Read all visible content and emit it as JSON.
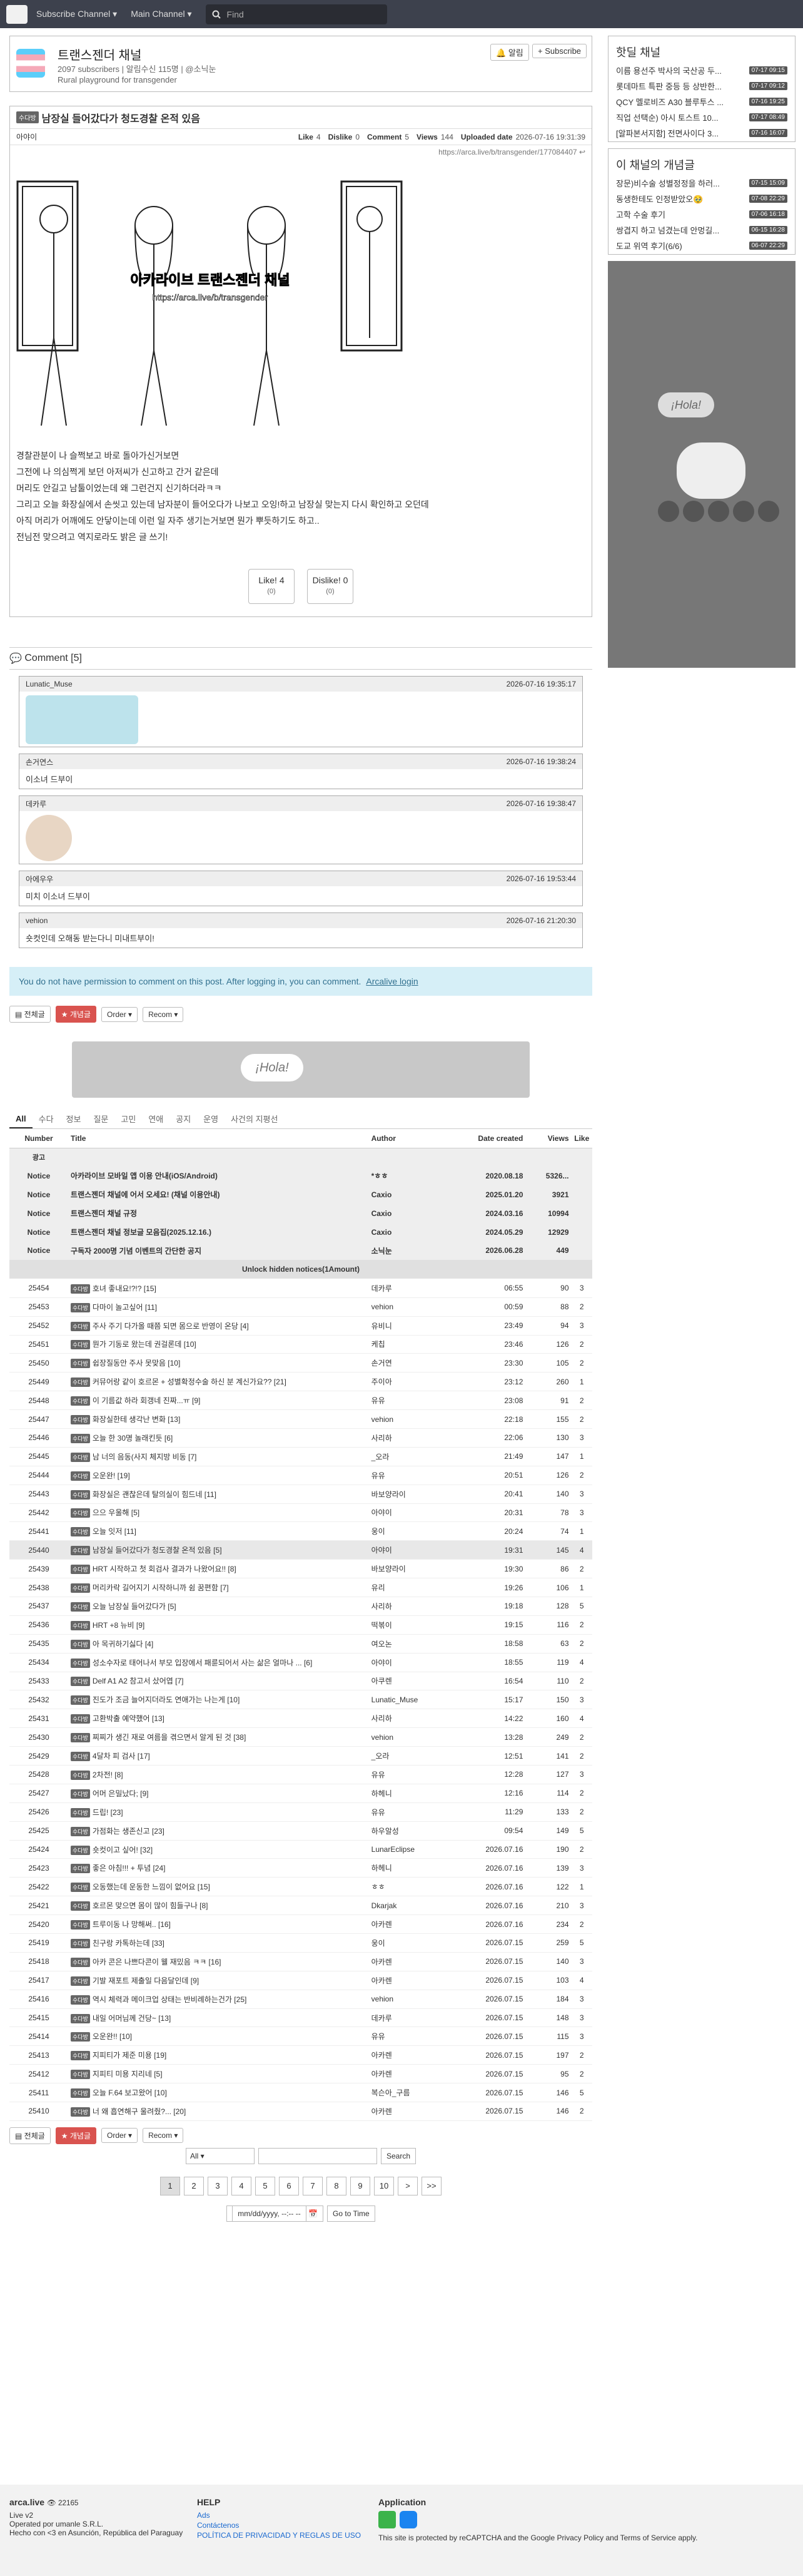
{
  "nav": {
    "subscribe_channel": "Subscribe Channel",
    "main_channel": "Main Channel",
    "find_placeholder": "Find"
  },
  "channel": {
    "title": "트랜스젠더 채널",
    "subscribers": "2097 subscribers",
    "notif": "알림수신 115명",
    "admin": "@소닉눈",
    "desc": "Rural playground for transgender",
    "notify_btn": "알림",
    "subscribe_btn": "Subscribe"
  },
  "article": {
    "category": "수다방",
    "title": "남장실 들어갔다가 청도경찰 온적 있음",
    "author": "아야이",
    "like_label": "Like",
    "like": "4",
    "dislike_label": "Dislike",
    "dislike": "0",
    "comment_label": "Comment",
    "comment": "5",
    "views_label": "Views",
    "views": "144",
    "uploaded_label": "Uploaded date",
    "uploaded": "2026-07-16 19:31:39",
    "url": "https://arca.live/b/transgender/177084407",
    "image_caption": "아카라이브 트랜스젠더 채널",
    "image_url": "https://arca.live/b/transgender",
    "body": [
      "경찰관분이 나 슬쩍보고 바로 돌아가신거보면",
      "그전에 나 의심쩍게 보던 아저씨가 신고하고 간거 같은데",
      "머리도 안길고 남툴이었는데 왜 그런건지 신기하더라ㅋㅋ",
      "그리고 오늘 화장실에서 손씻고 있는데 남자분이 들어오다가 나보고 오잉!하고 남장실 맞는지 다시 확인하고 오던데",
      "아직 머리가 어깨에도 안닿이는데 이런 일 자주 생기는거보면 뭔가 뿌듯하기도 하고..",
      "전님전 맞으려고 역지로라도 밝은 글 쓰기!"
    ],
    "like_btn": "Like!",
    "dislike_btn": "Dislike!",
    "like_sub": "(0)",
    "dislike_sub": "(0)"
  },
  "comments": {
    "header": "Comment [5]",
    "items": [
      {
        "author": "Lunatic_Muse",
        "time": "2026-07-16 19:35:17",
        "text": ""
      },
      {
        "author": "손거연스",
        "time": "2026-07-16 19:38:24",
        "text": "이소녀 드부이"
      },
      {
        "author": "데카루",
        "time": "2026-07-16 19:38:47",
        "text": ""
      },
      {
        "author": "아에우우",
        "time": "2026-07-16 19:53:44",
        "text": "미치 이소녀 드부이"
      },
      {
        "author": "vehion",
        "time": "2026-07-16 21:20:30",
        "text": "숏컷인데 오해동 받는다니 미내트부이!"
      }
    ]
  },
  "notice": {
    "text": "You do not have permission to comment on this post. After logging in, you can comment.",
    "link": "Arcalive login"
  },
  "controls": {
    "all": "전체글",
    "best": "개념글",
    "order": "Order",
    "recom": "Recom"
  },
  "tabs": [
    "All",
    "수다",
    "정보",
    "질문",
    "고민",
    "연애",
    "공지",
    "운영",
    "사건의 지평선"
  ],
  "table": {
    "headers": [
      "Number",
      "Title",
      "Author",
      "Date created",
      "Views",
      "Like"
    ],
    "ad": "광고",
    "notices": [
      {
        "n": "Notice",
        "t": "아카라이브 모바일 앱 이용 안내(iOS/Android)",
        "a": "*ㅎㅎ",
        "d": "2020.08.18",
        "v": "5326...",
        "l": ""
      },
      {
        "n": "Notice",
        "t": "트랜스젠더 채널에 어서 오세요! (채널 이용안내)",
        "a": "Caxio",
        "d": "2025.01.20",
        "v": "3921",
        "l": ""
      },
      {
        "n": "Notice",
        "t": "트랜스젠더 채널 규정",
        "a": "Caxio",
        "d": "2024.03.16",
        "v": "10994",
        "l": ""
      },
      {
        "n": "Notice",
        "t": "트랜스젠더 채널 정보글 모음집(2025.12.16.)",
        "a": "Caxio",
        "d": "2024.05.29",
        "v": "12929",
        "l": ""
      },
      {
        "n": "Notice",
        "t": "구독자 2000명 기념 이벤트의 간단한 공지",
        "a": "소닉눈",
        "d": "2026.06.28",
        "v": "449",
        "l": ""
      }
    ],
    "unlock": "Unlock hidden notices(1Amount)",
    "rows": [
      [
        "25454",
        "수다방",
        "호녀 좋내요!?!? [15]",
        "데카루",
        "06:55",
        "90",
        "3"
      ],
      [
        "25453",
        "수다방",
        "다마이 놀고싶어 [11]",
        "vehion",
        "00:59",
        "88",
        "2"
      ],
      [
        "25452",
        "수다방",
        "주사 주기 다가올 때쯤 되면 몸으로 반영이 온당 [4]",
        "유비니",
        "23:49",
        "94",
        "3"
      ],
      [
        "25451",
        "수다방",
        "뭔가 기동로 왔는데 권걸론데 [10]",
        "케칩",
        "23:46",
        "126",
        "2"
      ],
      [
        "25450",
        "수다방",
        "쉽장질동안 주사 못맞음 [10]",
        "손거연",
        "23:30",
        "105",
        "2"
      ],
      [
        "25449",
        "수다방",
        "커뮤어랑 같이 호르몬 + 성별확정수술 하신 분 계신가요?? [21]",
        "주이아",
        "23:12",
        "260",
        "1"
      ],
      [
        "25448",
        "수다방",
        "이 기름값 하라 회갱네 진짜...ㅠ [9]",
        "유유",
        "23:08",
        "91",
        "2"
      ],
      [
        "25447",
        "수다방",
        "화장실한테 생각난 변화 [13]",
        "vehion",
        "22:18",
        "155",
        "2"
      ],
      [
        "25446",
        "수다방",
        "오늘 한 30명 놀래킨듯 [6]",
        "사리하",
        "22:06",
        "130",
        "3"
      ],
      [
        "25445",
        "수다방",
        "남 너의 음동(사지 체지방 비동 [7]",
        "_오라",
        "21:49",
        "147",
        "1"
      ],
      [
        "25444",
        "수다방",
        "오운완! [19]",
        "유유",
        "20:51",
        "126",
        "2"
      ],
      [
        "25443",
        "수다방",
        "화장실은 괜찮은데 탈의실이 힘드네 [11]",
        "바보양라이",
        "20:41",
        "140",
        "3"
      ],
      [
        "25442",
        "수다방",
        "으으 우울해 [5]",
        "아야이",
        "20:31",
        "78",
        "3"
      ],
      [
        "25441",
        "수다방",
        "오늘 잇저 [11]",
        "웅이",
        "20:24",
        "74",
        "1"
      ],
      [
        "25440",
        "수다방",
        "남장실 들어갔다가 청도경찰 온적 있음 [5]",
        "아야이",
        "19:31",
        "145",
        "4"
      ],
      [
        "25439",
        "수다방",
        "HRT 시작하고 첫 회검사 결과가 나왔어요!! [8]",
        "바보양라이",
        "19:30",
        "86",
        "2"
      ],
      [
        "25438",
        "수다방",
        "머리카락 길어지기 시작하니까 쉼 꿈편함 [7]",
        "유리",
        "19:26",
        "106",
        "1"
      ],
      [
        "25437",
        "수다방",
        "오늘 남장실 들어갔다가 [5]",
        "사리하",
        "19:18",
        "128",
        "5"
      ],
      [
        "25436",
        "수다방",
        "HRT +8 뉴비 [9]",
        "떡볶이",
        "19:15",
        "116",
        "2"
      ],
      [
        "25435",
        "수다방",
        "아 목귀하기싫다 [4]",
        "여오논",
        "18:58",
        "63",
        "2"
      ],
      [
        "25434",
        "수다방",
        "성소수자로 태어나서 부모 입장에서 패륜되어서 사는 삶은 얼마나 ... [6]",
        "아야이",
        "18:55",
        "119",
        "4"
      ],
      [
        "25433",
        "수다방",
        "Delf A1 A2 참고서 샀어엽 [7]",
        "아쿠렌",
        "16:54",
        "110",
        "2"
      ],
      [
        "25432",
        "수다방",
        "진도가 조금 늘어지더라도 연애가는 나는게 [10]",
        "Lunatic_Muse",
        "15:17",
        "150",
        "3"
      ],
      [
        "25431",
        "수다방",
        "고환박출 예약했어 [13]",
        "사리하",
        "14:22",
        "160",
        "4"
      ],
      [
        "25430",
        "수다방",
        "찌찌가 생긴 재로 여름을 겪으면서 알게 된 것 [38]",
        "vehion",
        "13:28",
        "249",
        "2"
      ],
      [
        "25429",
        "수다방",
        "4달차 피 검사 [17]",
        "_오라",
        "12:51",
        "141",
        "2"
      ],
      [
        "25428",
        "수다방",
        "2차전! [8]",
        "유유",
        "12:28",
        "127",
        "3"
      ],
      [
        "25427",
        "수다방",
        "어머 은밀났다; [9]",
        "하헤니",
        "12:16",
        "114",
        "2"
      ],
      [
        "25426",
        "수다방",
        "드립! [23]",
        "유유",
        "11:29",
        "133",
        "2"
      ],
      [
        "25425",
        "수다방",
        "가점화는 생존신고 [23]",
        "하우알성",
        "09:54",
        "149",
        "5"
      ],
      [
        "25424",
        "수다방",
        "숏컷이고 싶어! [32]",
        "LunarEclipse",
        "2026.07.16",
        "190",
        "2"
      ],
      [
        "25423",
        "수다방",
        "좋은 아침!!! + 투념 [24]",
        "하헤니",
        "2026.07.16",
        "139",
        "3"
      ],
      [
        "25422",
        "수다방",
        "오동했는데 운동한 느낌이 없어요 [15]",
        "ㅎㅎ",
        "2026.07.16",
        "122",
        "1"
      ],
      [
        "25421",
        "수다방",
        "호르몬 맞으면 몸이 많이 힘들구나 [8]",
        "Dkarjak",
        "2026.07.16",
        "210",
        "3"
      ],
      [
        "25420",
        "수다방",
        "트루이동 나 망해써.. [16]",
        "아카렌",
        "2026.07.16",
        "234",
        "2"
      ],
      [
        "25419",
        "수다방",
        "친구랑 카톡하는데 [33]",
        "웅이",
        "2026.07.15",
        "259",
        "5"
      ],
      [
        "25418",
        "수다방",
        "아카 콘은 나쁘다콘이 웰 재밌음 ㅋㅋ [16]",
        "아카렌",
        "2026.07.15",
        "140",
        "3"
      ],
      [
        "25417",
        "수다방",
        "기발 재포트 제출일 다음달인데 [9]",
        "아카렌",
        "2026.07.15",
        "103",
        "4"
      ],
      [
        "25416",
        "수다방",
        "역시 체력과 메이크업 상태는 반비례하는건가 [25]",
        "vehion",
        "2026.07.15",
        "184",
        "3"
      ],
      [
        "25415",
        "수다방",
        "내일 어머님께 건당~ [13]",
        "데카루",
        "2026.07.15",
        "148",
        "3"
      ],
      [
        "25414",
        "수다방",
        "오운완!! [10]",
        "유유",
        "2026.07.15",
        "115",
        "3"
      ],
      [
        "25413",
        "수다방",
        "지피티가 제준 미용 [19]",
        "아카렌",
        "2026.07.15",
        "197",
        "2"
      ],
      [
        "25412",
        "수다방",
        "지피티 미용 지리네 [5]",
        "아카렌",
        "2026.07.15",
        "95",
        "2"
      ],
      [
        "25411",
        "수다방",
        "오늘 F.64 보고왔어 [10]",
        "복슨아_구름",
        "2026.07.15",
        "146",
        "5"
      ],
      [
        "25410",
        "수다방",
        "너 왜 흡연해구 울려줬?... [20]",
        "아카렌",
        "2026.07.15",
        "146",
        "2"
      ]
    ]
  },
  "search": {
    "scope": "All",
    "btn": "Search",
    "date": "mm/dd/yyyy, --:-- --",
    "goto": "Go to Time"
  },
  "pages": [
    "1",
    "2",
    "3",
    "4",
    "5",
    "6",
    "7",
    "8",
    "9",
    "10",
    ">",
    ">>"
  ],
  "footer": {
    "brand": "arca.live",
    "count": "22165",
    "version": "Live v2",
    "op": "Operated por umanle S.R.L.",
    "made": "Hecho con <3 en Asunción, República del Paraguay",
    "help": "HELP",
    "ads": "Ads",
    "contact": "Contáctenos",
    "policy": "POLÍTICA DE PRIVACIDAD Y REGLAS DE USO",
    "app": "Application",
    "recaptcha": "This site is protected by reCAPTCHA and the Google Privacy Policy and Terms of Service apply."
  },
  "sidebar": {
    "hot_title": "핫딜 채널",
    "hot": [
      {
        "t": "이름 용선주 박사의 국산공 두...",
        "tm": "07-17 09:15"
      },
      {
        "t": "롯데마트 특판 중등 등 상반한...",
        "tm": "07-17 09:12"
      },
      {
        "t": "QCY 멜로비즈 A30 블루투스 ...",
        "tm": "07-16 19:25"
      },
      {
        "t": "직업 선택순) 아시 토스트 10...",
        "tm": "07-17 08:49"
      },
      {
        "t": "[알파본서지함] 전면사이다 3...",
        "tm": "07-16 16:07"
      }
    ],
    "best_title": "이 채널의 개념글",
    "best": [
      {
        "t": "장문)비수술 성별정정을 하러...",
        "tm": "07-15 15:09"
      },
      {
        "t": "동생한테도 인정받았오🥹",
        "tm": "07-08 22:29"
      },
      {
        "t": "고학 수술 후기",
        "tm": "07-06 16:18"
      },
      {
        "t": "쌍겹지 하고 넘겼는데 안멍길...",
        "tm": "06-15 16:28"
      },
      {
        "t": "도교 위역 후기(6/6)",
        "tm": "06-07 22:29"
      }
    ],
    "ad_text": "¡Hola!"
  }
}
